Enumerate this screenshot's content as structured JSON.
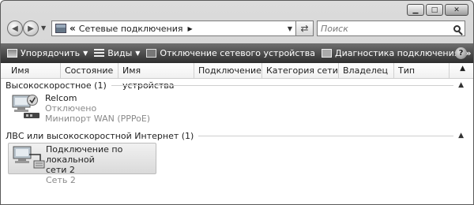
{
  "address": {
    "path": "Сетевые подключения"
  },
  "search": {
    "placeholder": "Поиск"
  },
  "toolbar": {
    "organize": "Упорядочить",
    "views": "Виды",
    "disable": "Отключение сетевого устройства",
    "diagnose": "Диагностика подключения",
    "more": "»",
    "help": "?"
  },
  "columns": [
    "Имя",
    "Состояние",
    "Имя устройства",
    "Подключение",
    "Категория сети",
    "Владелец",
    "Тип"
  ],
  "groups": [
    {
      "label": "Высокоскоростное (1)",
      "items": [
        {
          "name": "Relcom",
          "status": "Отключено",
          "device": "Минипорт WAN (PPPoE)"
        }
      ]
    },
    {
      "label": "ЛВС или высокоскоростной Интернет (1)",
      "items": [
        {
          "name_line1": "Подключение по локальной",
          "name_line2": "сети 2",
          "status": "Сеть 2"
        }
      ]
    }
  ]
}
